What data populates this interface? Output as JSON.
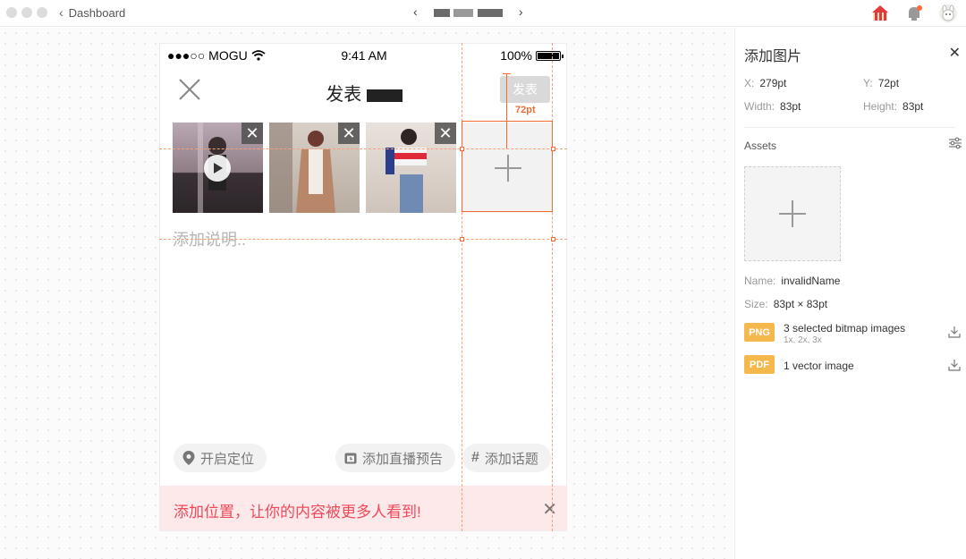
{
  "window": {
    "back_label": "Dashboard",
    "doc_title_blurred": "•"
  },
  "status_bar": {
    "carrier": "●●●○○ MOGU",
    "time": "9:41 AM",
    "battery": "100%"
  },
  "navbar": {
    "title": "发表",
    "publish_label": "发表"
  },
  "composer": {
    "placeholder": "添加说明.."
  },
  "chips": {
    "location": "开启定位",
    "live_preview": "添加直播预告",
    "topic": "添加话题"
  },
  "banner": {
    "text": "添加位置，让你的内容被更多人看到!"
  },
  "measure": {
    "label": "72pt"
  },
  "inspector": {
    "title": "添加图片",
    "x_label": "X:",
    "x_value": "279pt",
    "y_label": "Y:",
    "y_value": "72pt",
    "w_label": "Width:",
    "w_value": "83pt",
    "h_label": "Height:",
    "h_value": "83pt",
    "assets_label": "Assets",
    "name_label": "Name:",
    "name_value": "invalidName",
    "size_label": "Size:",
    "size_value": "83pt × 83pt",
    "png_badge": "PNG",
    "png_text": "3 selected bitmap images",
    "png_sub": "1x, 2x, 3x",
    "pdf_badge": "PDF",
    "pdf_text": "1 vector image"
  },
  "colors": {
    "accent_orange": "#f26b34",
    "badge_yellow": "#f5b84d",
    "banner_pink": "#fde8ea",
    "banner_text": "#ee4a5a"
  }
}
